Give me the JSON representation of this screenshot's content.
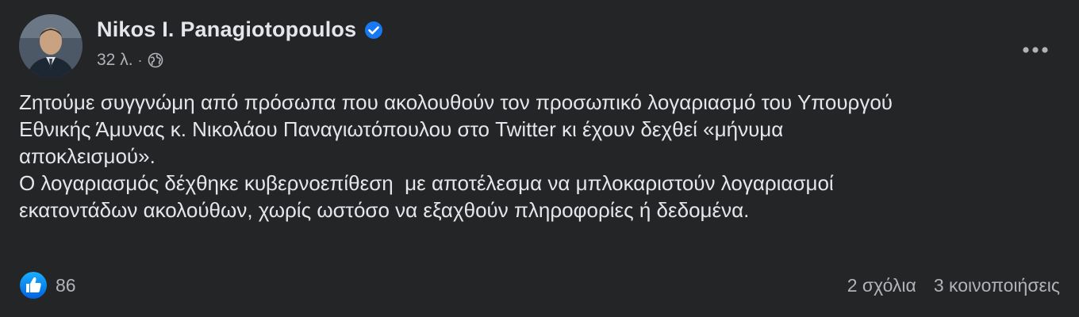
{
  "post": {
    "author": "Nikos I. Panagiotopoulos",
    "time": "32 λ.",
    "separator": "·",
    "icons": {
      "verified": "verified-badge-icon",
      "audience": "globe-icon",
      "more": "more-options-icon",
      "like": "like-reaction-icon"
    },
    "paragraphs": [
      "Ζητούμε συγγνώμη από πρόσωπα που ακολουθούν τον προσωπικό λογαριασμό του Υπουργού\nΕθνικής Άμυνας κ. Νικολάου Παναγιωτόπουλου στο Twitter κι έχουν δεχθεί «μήνυμα\nαποκλεισμού».",
      "Ο λογαριασμός δέχθηκε κυβερνοεπίθεση  με αποτέλεσμα να μπλοκαριστούν λογαριασμοί\nεκατοντάδων ακολούθων, χωρίς ωστόσο να εξαχθούν πληροφορίες ή δεδομένα."
    ],
    "reactions_count": "86",
    "comments": "2 σχόλια",
    "shares": "3 κοινοποιήσεις"
  },
  "colors": {
    "background": "#242526",
    "primary_text": "#e4e6eb",
    "secondary_text": "#b0b3b8",
    "accent_blue": "#1877f2"
  }
}
